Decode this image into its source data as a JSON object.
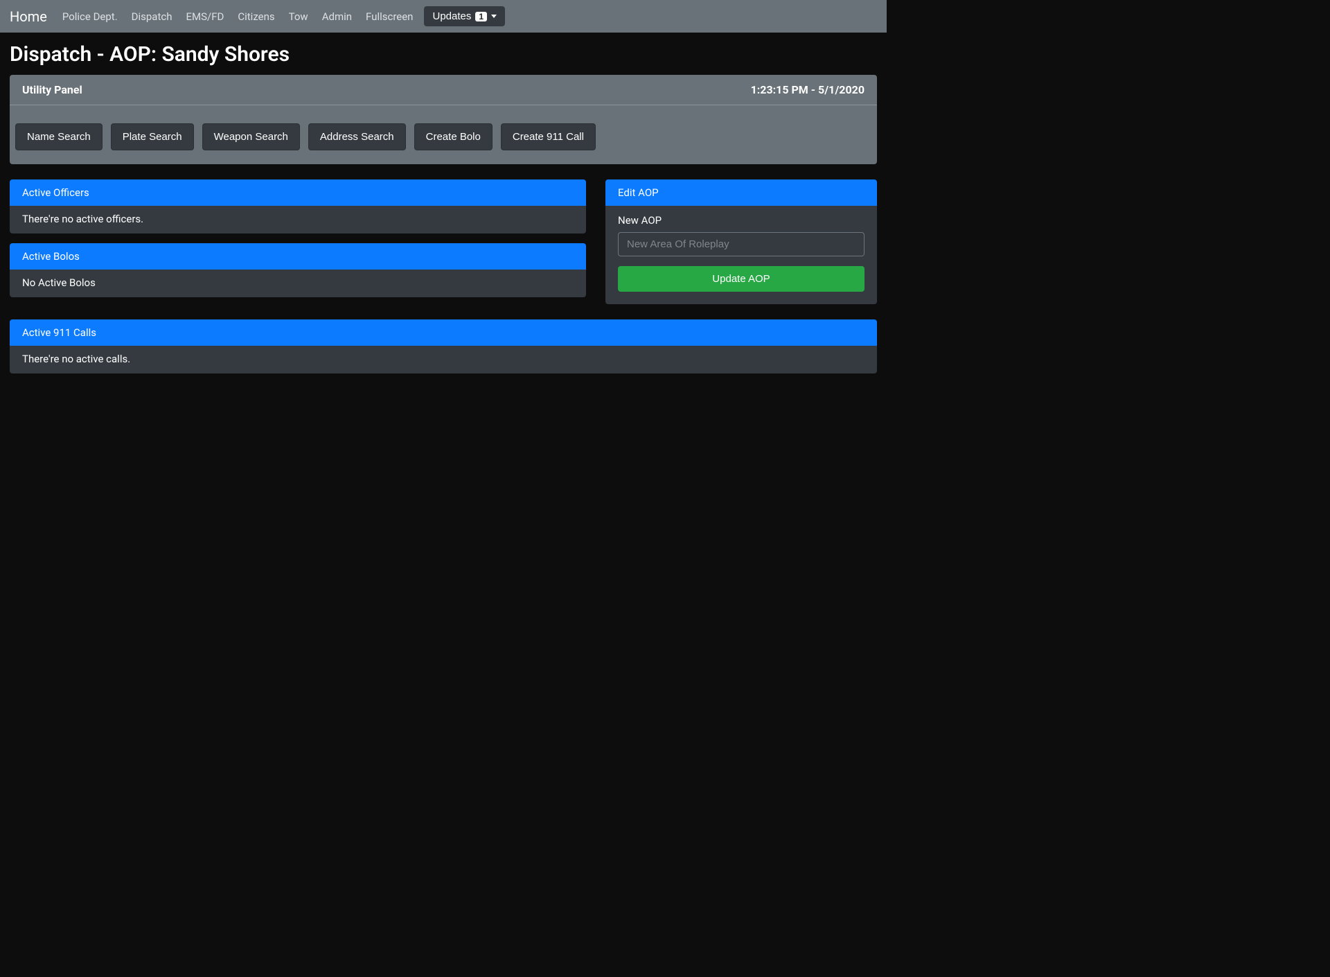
{
  "nav": {
    "brand": "Home",
    "links": [
      "Police Dept.",
      "Dispatch",
      "EMS/FD",
      "Citizens",
      "Tow",
      "Admin",
      "Fullscreen"
    ],
    "updates_label": "Updates",
    "updates_count": "1"
  },
  "page_title": "Dispatch - AOP: Sandy Shores",
  "utility": {
    "title": "Utility Panel",
    "timestamp": "1:23:15 PM - 5/1/2020",
    "buttons": [
      "Name Search",
      "Plate Search",
      "Weapon Search",
      "Address Search",
      "Create Bolo",
      "Create 911 Call"
    ]
  },
  "officers": {
    "header": "Active Officers",
    "body": "There're no active officers."
  },
  "bolos": {
    "header": "Active Bolos",
    "body": "No Active Bolos"
  },
  "edit_aop": {
    "header": "Edit AOP",
    "label": "New AOP",
    "placeholder": "New Area Of Roleplay",
    "button": "Update AOP"
  },
  "calls": {
    "header": "Active 911 Calls",
    "body": "There're no active calls."
  }
}
